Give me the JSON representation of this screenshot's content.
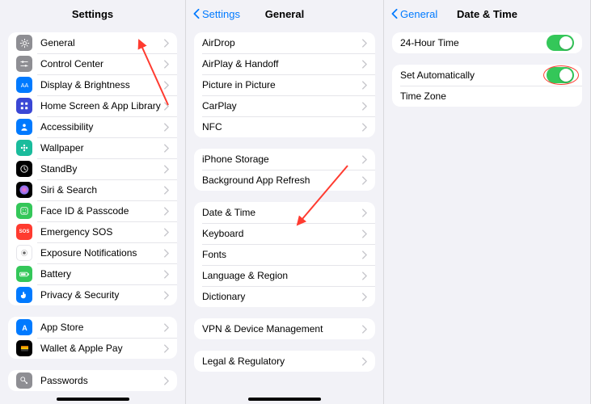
{
  "panel1": {
    "title": "Settings",
    "group1": [
      {
        "label": "General",
        "icon": "gear-icon",
        "bg": "bg-gray"
      },
      {
        "label": "Control Center",
        "icon": "sliders-icon",
        "bg": "bg-gray"
      },
      {
        "label": "Display & Brightness",
        "icon": "sun-icon",
        "bg": "bg-blue"
      },
      {
        "label": "Home Screen & App Library",
        "icon": "grid-icon",
        "bg": "bg-indigo"
      },
      {
        "label": "Accessibility",
        "icon": "person-icon",
        "bg": "bg-blue"
      },
      {
        "label": "Wallpaper",
        "icon": "flower-icon",
        "bg": "bg-teal"
      },
      {
        "label": "StandBy",
        "icon": "clock-icon",
        "bg": "bg-black"
      },
      {
        "label": "Siri & Search",
        "icon": "siri-icon",
        "bg": "bg-black"
      },
      {
        "label": "Face ID & Passcode",
        "icon": "face-icon",
        "bg": "bg-green"
      },
      {
        "label": "Emergency SOS",
        "icon": "sos-icon",
        "bg": "bg-redsos",
        "text": "SOS"
      },
      {
        "label": "Exposure Notifications",
        "icon": "exposure-icon",
        "bg": "bg-white"
      },
      {
        "label": "Battery",
        "icon": "battery-icon",
        "bg": "bg-green"
      },
      {
        "label": "Privacy & Security",
        "icon": "hand-icon",
        "bg": "bg-blue"
      }
    ],
    "group2": [
      {
        "label": "App Store",
        "icon": "appstore-icon",
        "bg": "bg-blue"
      },
      {
        "label": "Wallet & Apple Pay",
        "icon": "wallet-icon",
        "bg": "bg-black"
      }
    ],
    "group3": [
      {
        "label": "Passwords",
        "icon": "key-icon",
        "bg": "bg-gray"
      }
    ]
  },
  "panel2": {
    "back": "Settings",
    "title": "General",
    "group1": [
      "AirDrop",
      "AirPlay & Handoff",
      "Picture in Picture",
      "CarPlay",
      "NFC"
    ],
    "group2": [
      "iPhone Storage",
      "Background App Refresh"
    ],
    "group3": [
      "Date & Time",
      "Keyboard",
      "Fonts",
      "Language & Region",
      "Dictionary"
    ],
    "group4": [
      "VPN & Device Management"
    ],
    "group5": [
      "Legal & Regulatory"
    ]
  },
  "panel3": {
    "back": "General",
    "title": "Date & Time",
    "group1": [
      {
        "label": "24-Hour Time",
        "toggle": true
      }
    ],
    "group2": [
      {
        "label": "Set Automatically",
        "toggle": true,
        "highlight": true
      },
      {
        "label": "Time Zone",
        "chevron": false
      }
    ]
  }
}
